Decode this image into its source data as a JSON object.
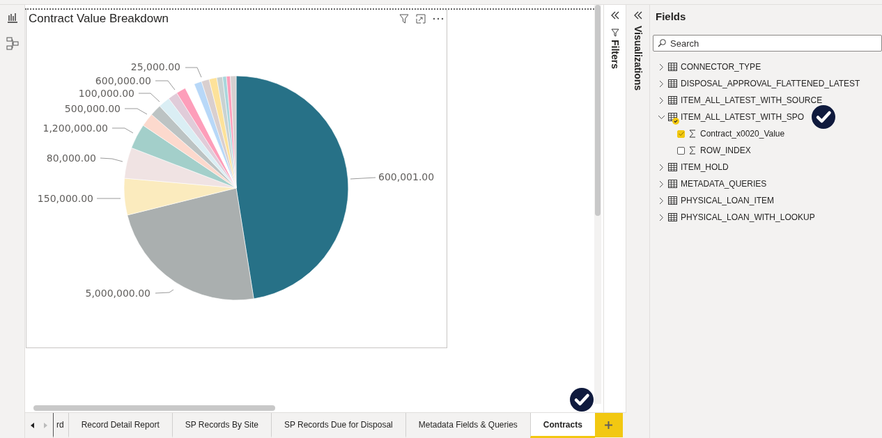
{
  "visual": {
    "title": "Contract Value Breakdown",
    "pie_labels": [
      "25,000.00",
      "600,000.00",
      "100,000.00",
      "500,000.00",
      "1,200,000.00",
      "80,000.00",
      "600,001.00",
      "150,000.00",
      "5,000,000.00"
    ]
  },
  "page_tabs": {
    "partial_tab": "rd",
    "tabs": [
      {
        "label": "Record Detail Report",
        "selected": false
      },
      {
        "label": "SP Records By Site",
        "selected": false
      },
      {
        "label": "SP Records Due for Disposal",
        "selected": false
      },
      {
        "label": "Metadata Fields & Queries",
        "selected": false
      },
      {
        "label": "Contracts",
        "selected": true
      }
    ]
  },
  "filters_pane": {
    "title": "Filters"
  },
  "visualizations_pane": {
    "title": "Visualizations"
  },
  "fields_pane": {
    "title": "Fields",
    "search": {
      "placeholder": "Search"
    },
    "tables": [
      {
        "name": "CONNECTOR_TYPE",
        "expanded": false,
        "in_use": false
      },
      {
        "name": "DISPOSAL_APPROVAL_FLATTENED_LATEST",
        "expanded": false,
        "in_use": false
      },
      {
        "name": "ITEM_ALL_LATEST_WITH_SOURCE",
        "expanded": false,
        "in_use": false
      },
      {
        "name": "ITEM_ALL_LATEST_WITH_SPO",
        "expanded": true,
        "in_use": true,
        "children": [
          {
            "name": "Contract_x0020_Value",
            "checked": true
          },
          {
            "name": "ROW_INDEX",
            "checked": false
          }
        ]
      },
      {
        "name": "ITEM_HOLD",
        "expanded": false,
        "in_use": false
      },
      {
        "name": "METADATA_QUERIES",
        "expanded": false,
        "in_use": false
      },
      {
        "name": "PHYSICAL_LOAN_ITEM",
        "expanded": false,
        "in_use": false
      },
      {
        "name": "PHYSICAL_LOAN_WITH_LOOKUP",
        "expanded": false,
        "in_use": false
      }
    ]
  }
}
